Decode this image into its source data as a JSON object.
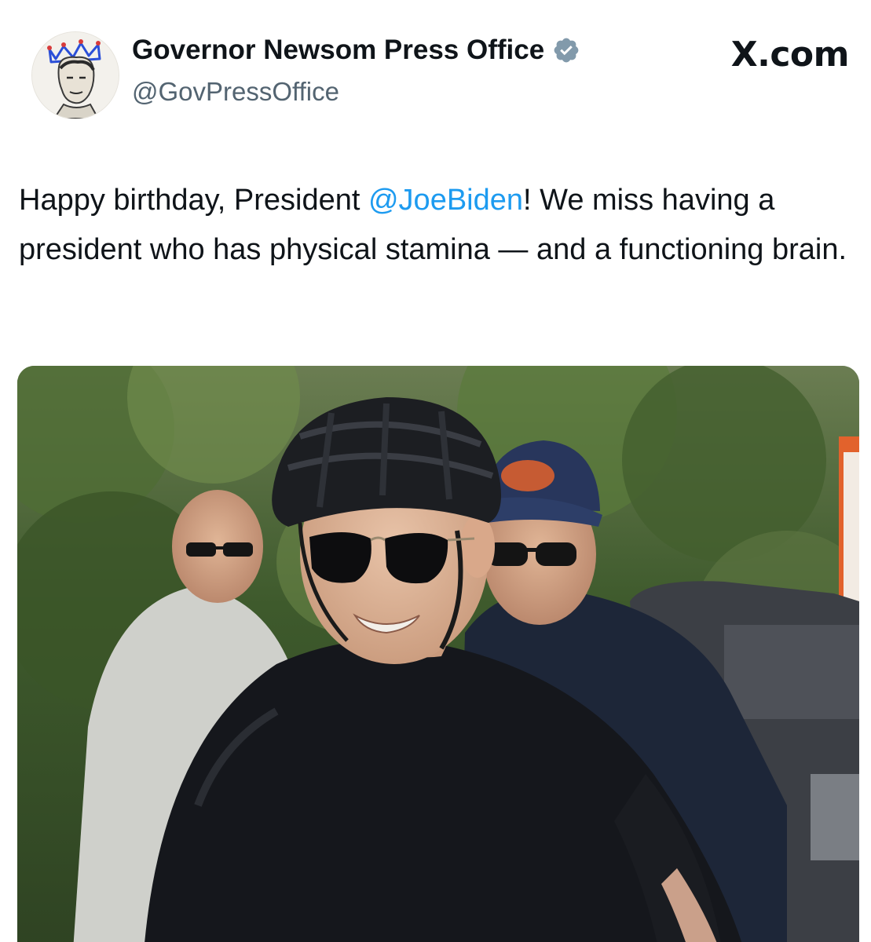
{
  "post": {
    "display_name": "Governor Newsom Press Office",
    "handle": "@GovPressOffice",
    "verified": true,
    "brand": "X.com",
    "text": {
      "part1": "Happy birthday, President ",
      "mention": "@JoeBiden",
      "part2": "! We miss having a president who has physical stamina — and a functioning brain."
    }
  },
  "icons": {
    "avatar": "crowned-portrait-avatar",
    "verified": "verified-badge-icon"
  },
  "colors": {
    "text": "#0f1419",
    "secondary": "#536471",
    "mention": "#1d9bf0",
    "background": "#ffffff"
  },
  "photo": {
    "subject": "man in black helmet and aviator sunglasses riding a bicycle, with two men in the background"
  }
}
